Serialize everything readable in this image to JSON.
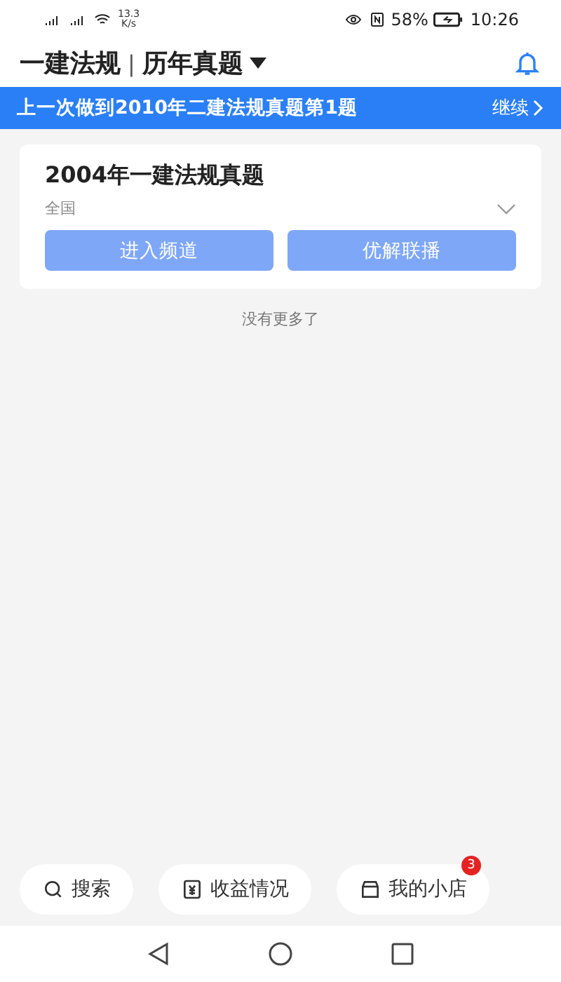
{
  "status_bar": {
    "speed": "13.3",
    "speed_unit": "K/s",
    "battery": "58%",
    "time": "10:26"
  },
  "header": {
    "subject": "一建法规",
    "separator": "|",
    "section": "历年真题"
  },
  "resume_banner": {
    "text": "上一次做到2010年二建法规真题第1题",
    "action": "继续"
  },
  "papers": [
    {
      "title": "2004年一建法规真题",
      "region": "全国",
      "expanded": false,
      "buttons": [
        "进入频道",
        "优解联播"
      ]
    }
  ],
  "end_note": "没有更多了",
  "bottom_actions": [
    {
      "kind": "search",
      "label": "搜索"
    },
    {
      "kind": "income",
      "label": "收益情况"
    },
    {
      "kind": "shop",
      "label": "我的小店",
      "badge": "3"
    }
  ]
}
